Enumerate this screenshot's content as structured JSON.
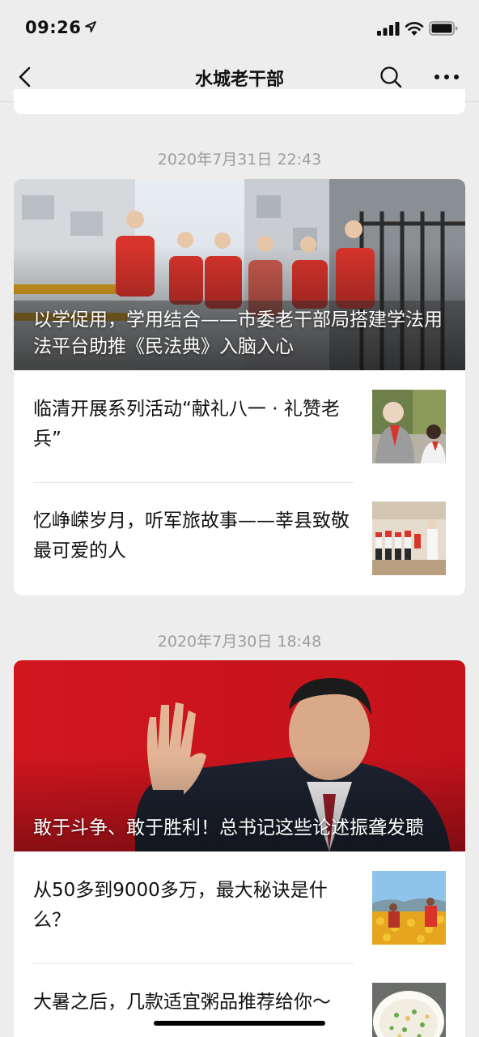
{
  "status_bar": {
    "time": "09:26"
  },
  "nav": {
    "title": "水城老干部"
  },
  "feed": [
    {
      "timestamp": "2020年7月31日 22:43",
      "cover_title": "以学促用，学用结合——市委老干部局搭建学法用法平台助推《民法典》入脑入心",
      "articles": [
        {
          "title": "临清开展系列活动“献礼八一 · 礼赞老兵”"
        },
        {
          "title": "忆峥嵘岁月，听军旅故事——莘县致敬最可爱的人"
        }
      ]
    },
    {
      "timestamp": "2020年7月30日 18:48",
      "cover_title": "敢于斗争、敢于胜利！总书记这些论述振聋发聩",
      "articles": [
        {
          "title": "从50多到9000多万，最大秘诀是什么？"
        },
        {
          "title": "大暑之后，几款适宜粥品推荐给你～"
        }
      ]
    }
  ]
}
